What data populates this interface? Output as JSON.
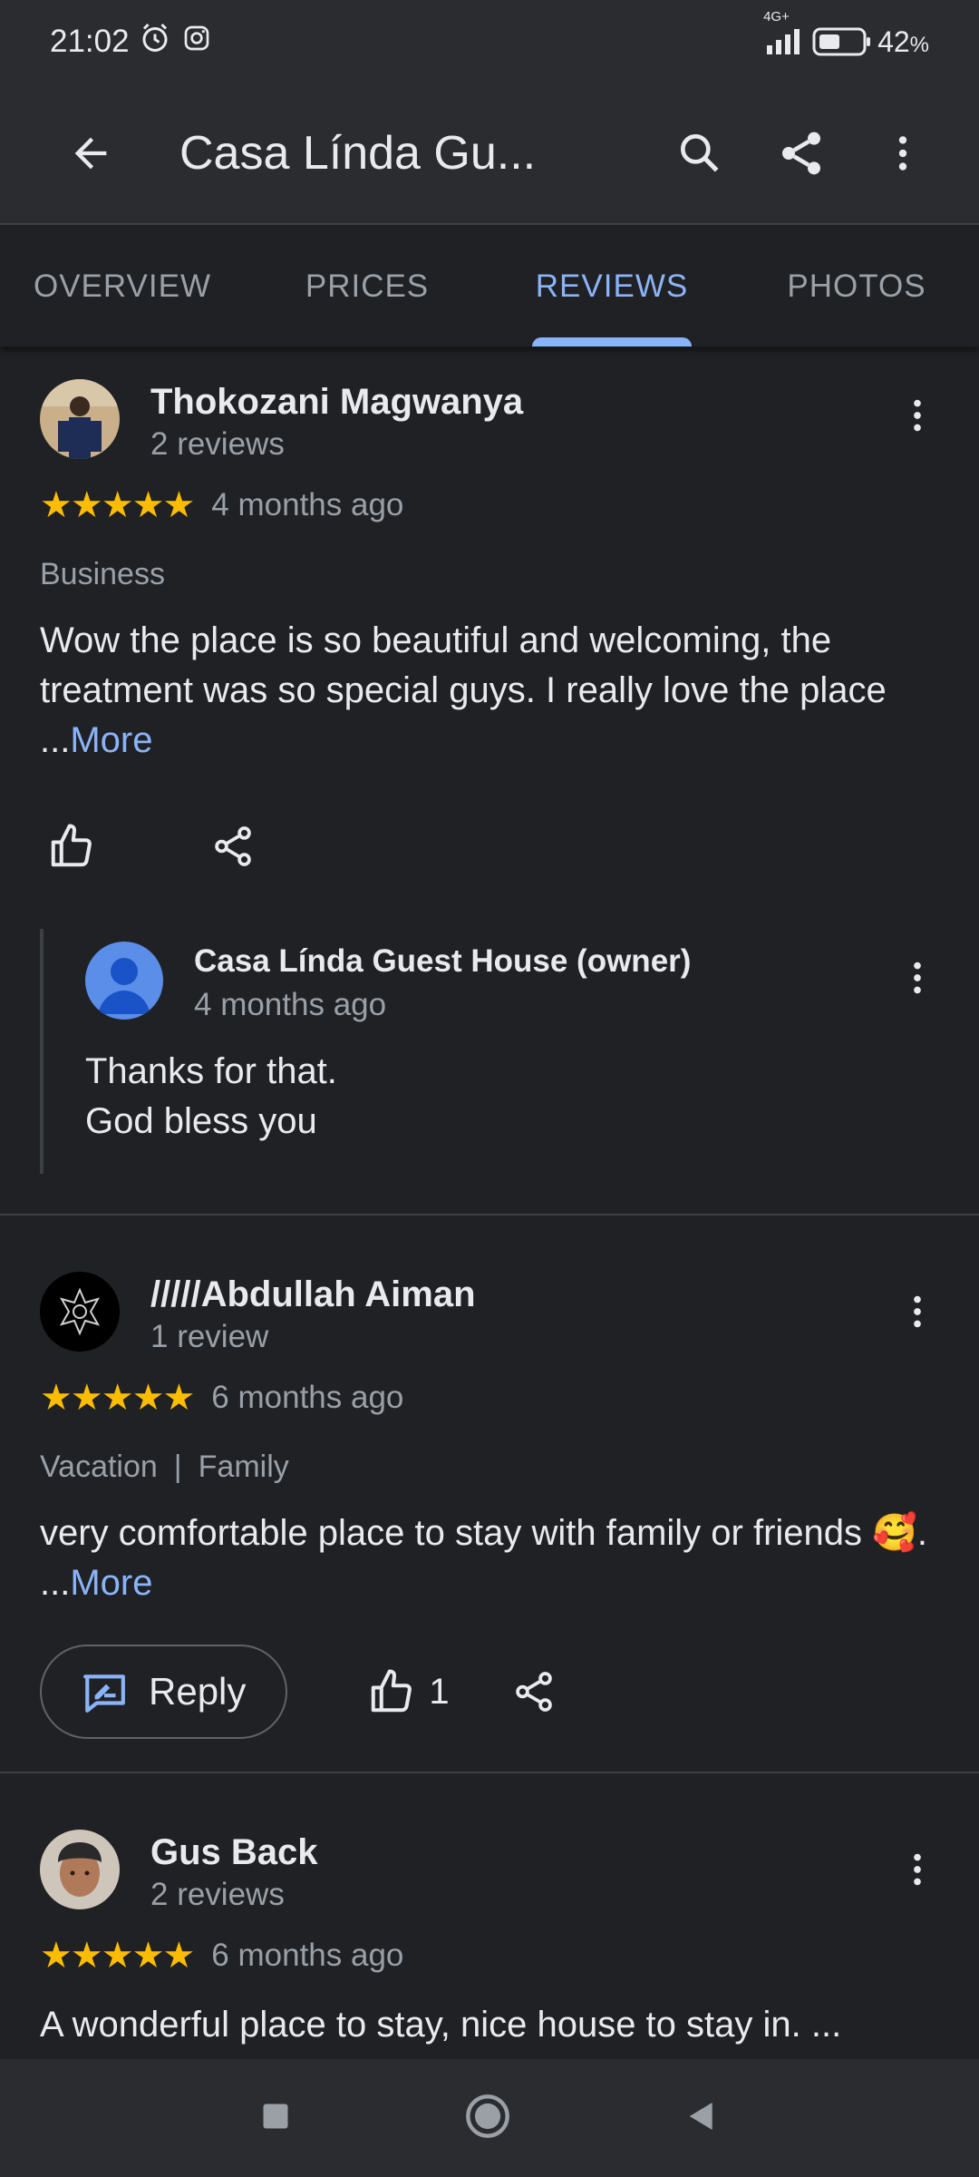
{
  "status_bar": {
    "time": "21:02",
    "network": "4G+",
    "battery_percent": "42",
    "battery_unit": "%",
    "icons": [
      "alarm-icon",
      "instagram-icon",
      "signal-icon",
      "battery-icon"
    ]
  },
  "app_bar": {
    "title": "Casa Línda Gu...",
    "icons": [
      "back-arrow-icon",
      "search-icon",
      "share-icon",
      "more-vert-icon"
    ]
  },
  "tabs": [
    {
      "label": "OVERVIEW",
      "active": false
    },
    {
      "label": "PRICES",
      "active": false
    },
    {
      "label": "REVIEWS",
      "active": true
    },
    {
      "label": "PHOTOS",
      "active": false
    }
  ],
  "reviews": [
    {
      "name": "Thokozani Magwanya",
      "count": "2 reviews",
      "rating": 5,
      "date": "4 months ago",
      "tags": [
        "Business"
      ],
      "text": "Wow the place is so beautiful and welcoming, the treatment was so special guys. I really love the place ...",
      "more": "More",
      "owner_reply": {
        "name": "Casa Línda Guest House (owner)",
        "date": "4 months ago",
        "text": "Thanks for that.\nGod bless you"
      }
    },
    {
      "name": "/////Abdullah Aiman",
      "count": "1 review",
      "rating": 5,
      "date": "6 months ago",
      "tags": [
        "Vacation",
        "Family"
      ],
      "text": "very comfortable place to stay with family or friends 🥰. ...",
      "more": "More",
      "reply_label": "Reply",
      "likes": "1"
    },
    {
      "name": "Gus Back",
      "count": "2 reviews",
      "rating": 5,
      "date": "6 months ago",
      "text": "A wonderful place to stay, nice house to stay in. ..."
    }
  ],
  "stars_glyph": "★★★★★",
  "colors": {
    "background": "#202124",
    "accent": "#8ab4f8",
    "star": "#fbbc04",
    "secondary_text": "#9aa0a6"
  }
}
